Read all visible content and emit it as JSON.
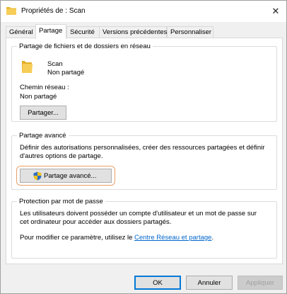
{
  "window": {
    "title": "Propriétés de : Scan",
    "close_symbol": "✕"
  },
  "tabs": [
    {
      "label": "Général",
      "active": false
    },
    {
      "label": "Partage",
      "active": true
    },
    {
      "label": "Sécurité",
      "active": false
    },
    {
      "label": "Versions précédentes",
      "active": false
    },
    {
      "label": "Personnaliser",
      "active": false
    }
  ],
  "network_sharing": {
    "legend": "Partage de fichiers et de dossiers en réseau",
    "folder_name": "Scan",
    "status": "Non partagé",
    "path_label": "Chemin réseau :",
    "path_value": "Non partagé",
    "share_button": "Partager..."
  },
  "advanced_sharing": {
    "legend": "Partage avancé",
    "description_line1": "Définir des autorisations personnalisées, créer des ressources partagées et définir",
    "description_line2": "d'autres options de partage.",
    "button": "Partage avancé...",
    "highlight_color": "#e8a068"
  },
  "password_protection": {
    "legend": "Protection par mot de passe",
    "description_line1": "Les utilisateurs doivent posséder un compte d'utilisateur et un mot de passe sur",
    "description_line2": "cet ordinateur pour accéder aux dossiers partagés.",
    "modify_text": "Pour modifier ce paramètre, utilisez le",
    "link_text": "Centre Réseau et partage",
    "link_suffix": "."
  },
  "footer": {
    "ok": "OK",
    "cancel": "Annuler",
    "apply": "Appliquer"
  },
  "icons": {
    "title": "folder-icon",
    "folder": "folder-icon",
    "shield": "uac-shield-icon"
  },
  "colors": {
    "link": "#0066cc",
    "focus": "#0078d7",
    "folder": "#f0c54a"
  }
}
